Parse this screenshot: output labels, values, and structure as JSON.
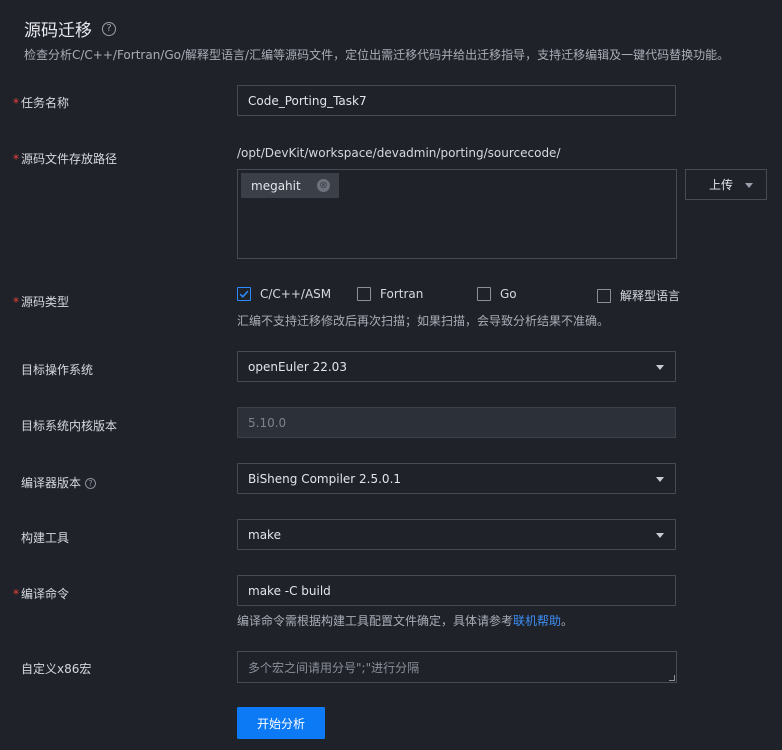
{
  "header": {
    "title": "源码迁移",
    "help_icon": "?",
    "description": "检查分析C/C++/Fortran/Go/解释型语言/汇编等源码文件，定位出需迁移代码并给出迁移指导，支持迁移编辑及一键代码替换功能。"
  },
  "required_mark": "*",
  "task_name": {
    "label": "任务名称",
    "value": "Code_Porting_Task7"
  },
  "source_path": {
    "label": "源码文件存放路径",
    "path": "/opt/DevKit/workspace/devadmin/porting/sourcecode/",
    "tag": "megahit",
    "tag_close": "⊗",
    "upload_label": "上传"
  },
  "source_type": {
    "label": "源码类型",
    "options": [
      {
        "label": "C/C++/ASM",
        "checked": true
      },
      {
        "label": "Fortran",
        "checked": false
      },
      {
        "label": "Go",
        "checked": false
      },
      {
        "label": "解释型语言",
        "checked": false
      }
    ],
    "note": "汇编不支持迁移修改后再次扫描；如果扫描，会导致分析结果不准确。"
  },
  "target_os": {
    "label": "目标操作系统",
    "value": "openEuler 22.03"
  },
  "kernel_version": {
    "label": "目标系统内核版本",
    "value": "5.10.0"
  },
  "compiler": {
    "label": "编译器版本",
    "help": "?",
    "value": "BiSheng Compiler 2.5.0.1"
  },
  "build_tool": {
    "label": "构建工具",
    "value": "make"
  },
  "compile_cmd": {
    "label": "编译命令",
    "value": "make -C build",
    "note_prefix": "编译命令需根据构建工具配置文件确定，具体请参考",
    "note_link": "联机帮助",
    "note_suffix": "。"
  },
  "x86_macro": {
    "label": "自定义x86宏",
    "placeholder": "多个宏之间请用分号\";\"进行分隔"
  },
  "start_button": "开始分析",
  "colors": {
    "accent": "#0d7af5",
    "required": "#e8433b",
    "link": "#3d8ff5"
  }
}
